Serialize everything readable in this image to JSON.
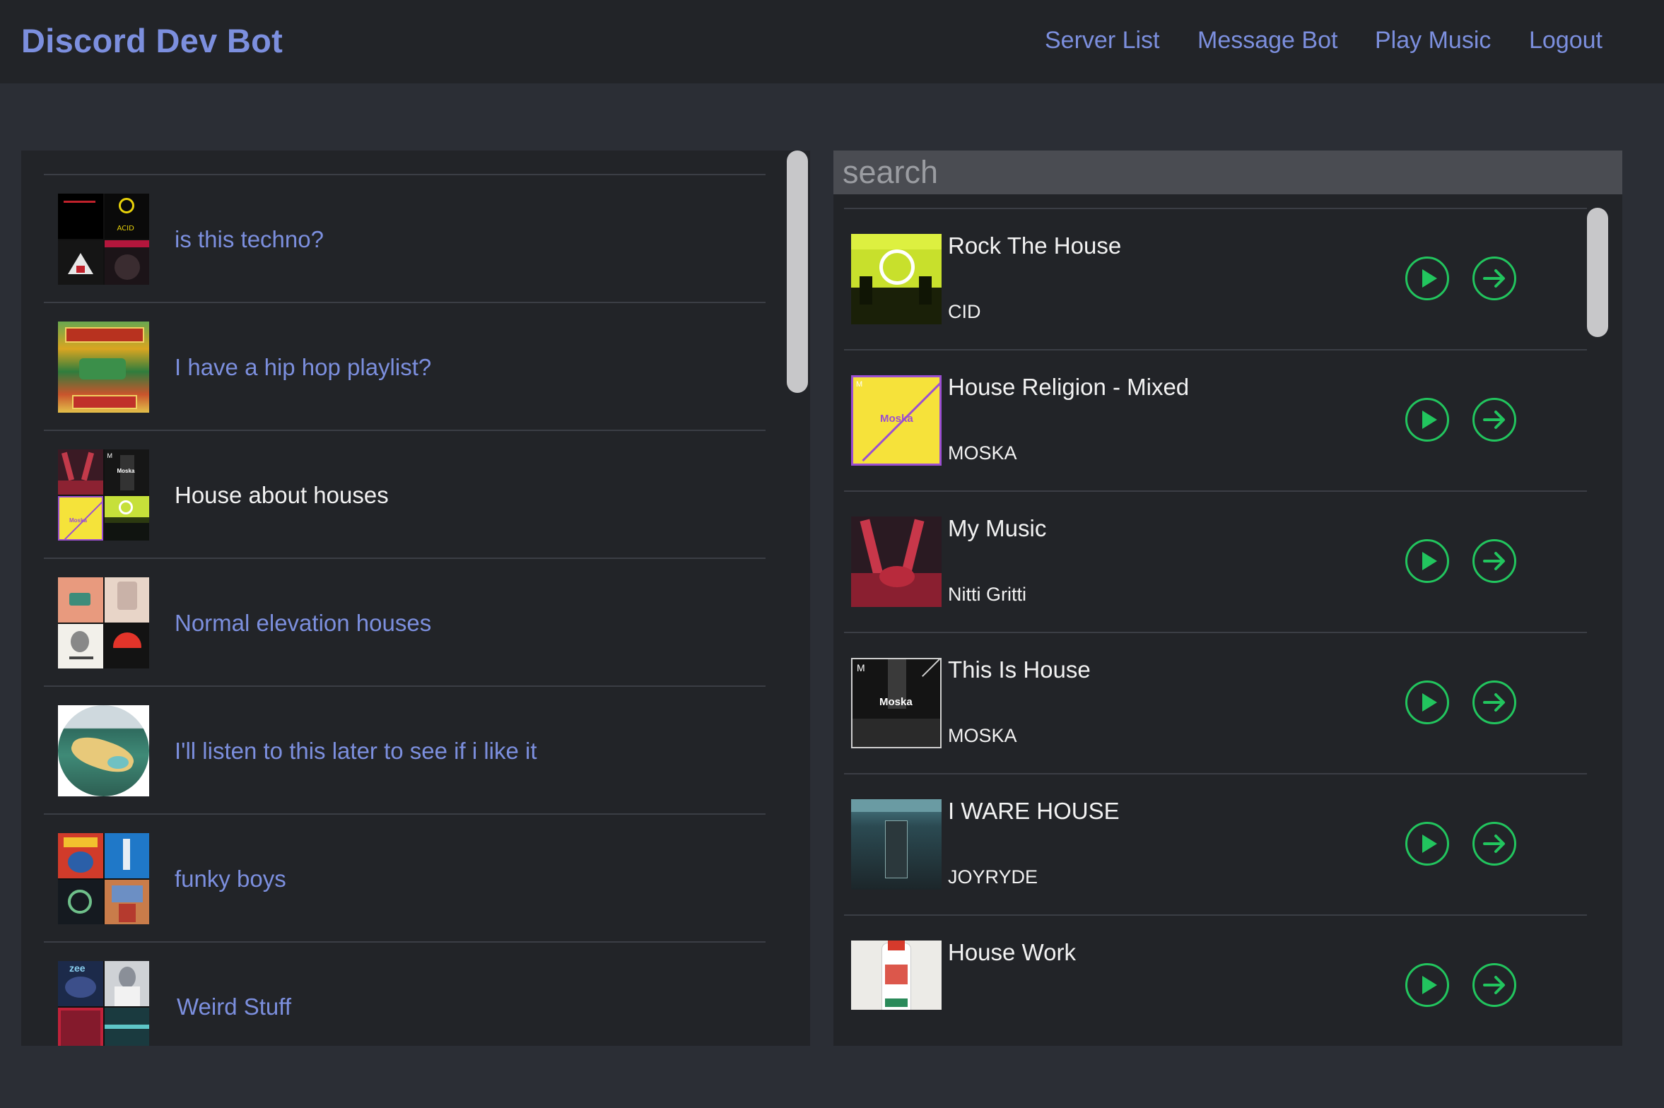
{
  "app": {
    "brand": "Discord Dev Bot"
  },
  "nav": {
    "links": [
      "Server List",
      "Message Bot",
      "Play Music",
      "Logout"
    ]
  },
  "playlists": [
    {
      "name": "is this techno?",
      "active": false
    },
    {
      "name": "I have a hip hop playlist?",
      "active": false
    },
    {
      "name": "House about houses",
      "active": true
    },
    {
      "name": "Normal elevation houses",
      "active": false
    },
    {
      "name": "I'll listen to this later to see if i like it",
      "active": false
    },
    {
      "name": "funky boys",
      "active": false
    },
    {
      "name": "Weird Stuff",
      "active": false
    }
  ],
  "search": {
    "placeholder": "search"
  },
  "tracks": [
    {
      "title": "Rock The House",
      "artist": "CID"
    },
    {
      "title": "House Religion - Mixed",
      "artist": "MOSKA"
    },
    {
      "title": "My Music",
      "artist": "Nitti Gritti"
    },
    {
      "title": "This Is House",
      "artist": "MOSKA"
    },
    {
      "title": "I WARE HOUSE",
      "artist": "JOYRYDE"
    },
    {
      "title": "House Work",
      "artist": ""
    }
  ],
  "colors": {
    "accent": "#7c8fde",
    "play_green": "#22c55e",
    "background": "#2b2e35",
    "panel": "#222428"
  },
  "icons": {
    "play": "play-circle-icon",
    "add": "arrow-right-circle-icon"
  }
}
